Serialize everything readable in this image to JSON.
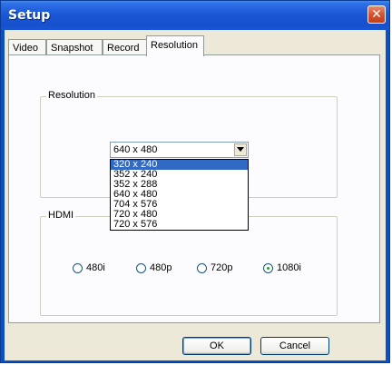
{
  "window": {
    "title": "Setup"
  },
  "tabs": [
    {
      "label": "Video"
    },
    {
      "label": "Snapshot"
    },
    {
      "label": "Record"
    },
    {
      "label": "Resolution"
    }
  ],
  "resolution": {
    "group_label": "Resolution",
    "selected_value": "640 x 480",
    "options": [
      "320 x 240",
      "352 x 240",
      "352 x 288",
      "640 x 480",
      "704 x 576",
      "720 x 480",
      "720 x 576"
    ],
    "highlighted_option": "320 x 240"
  },
  "hdmi": {
    "group_label": "HDMI",
    "options": [
      {
        "label": "480i",
        "checked": false
      },
      {
        "label": "480p",
        "checked": false
      },
      {
        "label": "720p",
        "checked": false
      },
      {
        "label": "1080i",
        "checked": true
      }
    ]
  },
  "buttons": {
    "ok": "OK",
    "cancel": "Cancel"
  },
  "colors": {
    "titlebar": "#1a58d6",
    "selection": "#316ac5",
    "close": "#d3542e"
  }
}
